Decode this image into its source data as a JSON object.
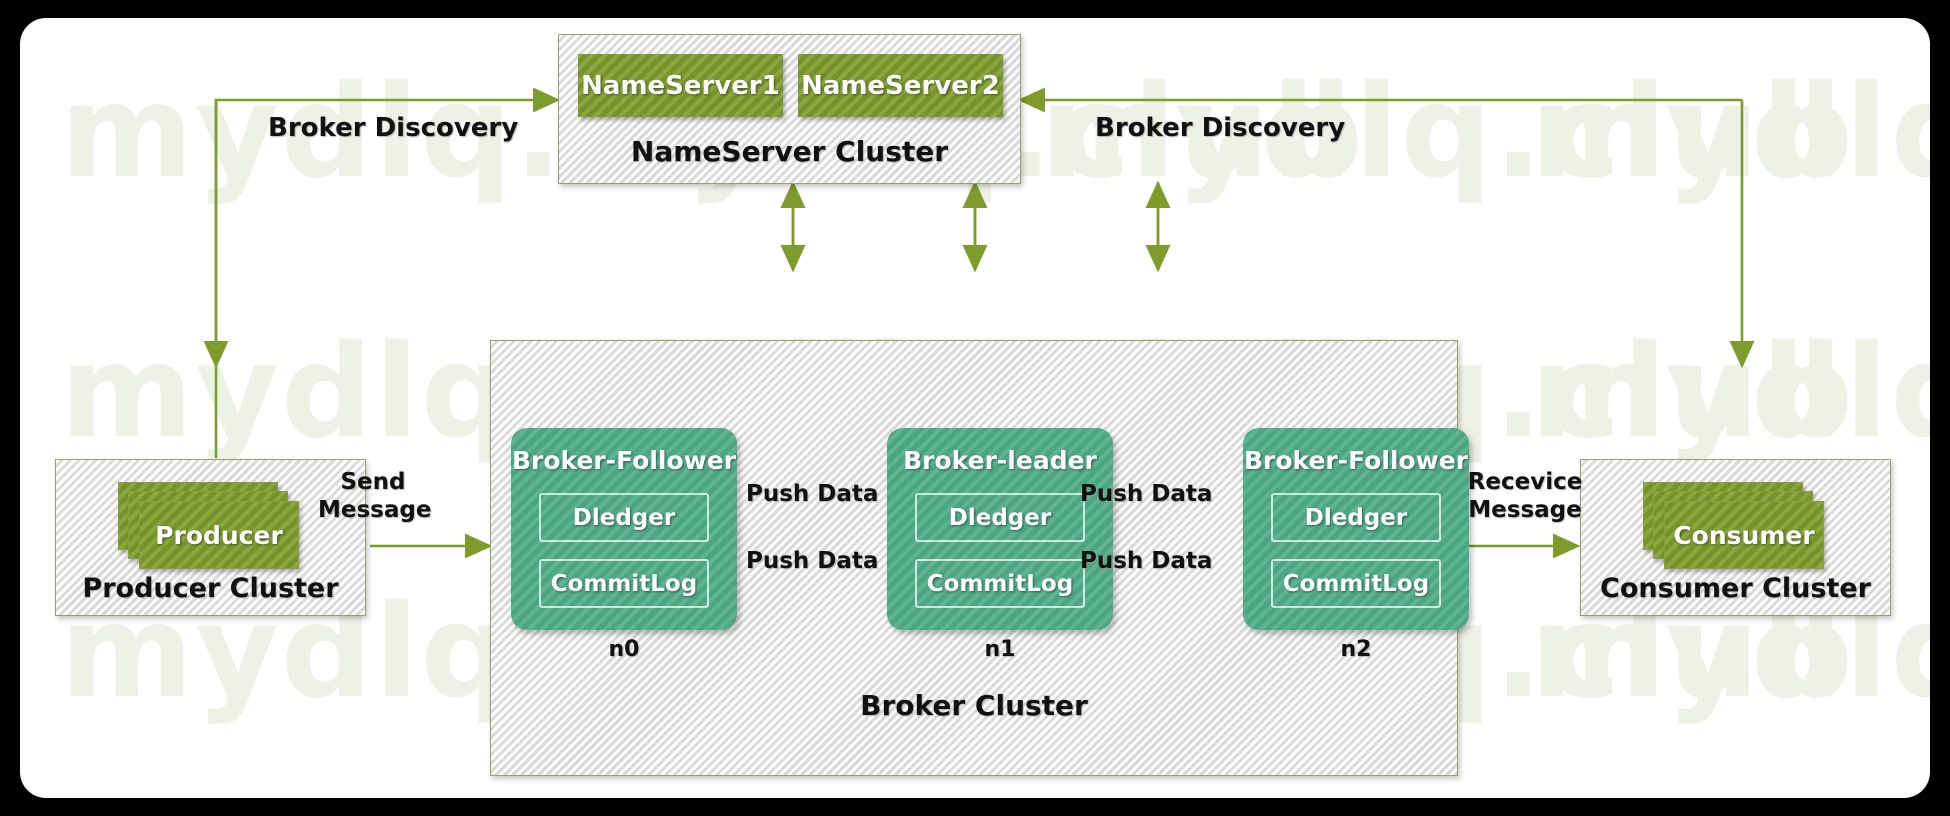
{
  "diagram": {
    "title": "RocketMQ DLedger Cluster Architecture",
    "watermark_text": "mydlq.club",
    "colors": {
      "olive_green": "#7d9c2b",
      "teal_green": "#4fac89",
      "arrow_green": "#7d9c2b",
      "arrow_brown": "#b5651d",
      "cluster_border": "#9aa06a",
      "cluster_fill": "#f2f2f2",
      "frame_black": "#000000"
    }
  },
  "nameserver_cluster": {
    "title": "NameServer Cluster",
    "nodes": [
      {
        "label": "NameServer1"
      },
      {
        "label": "NameServer2"
      }
    ]
  },
  "producer_cluster": {
    "title": "Producer Cluster",
    "node_label": "Producer"
  },
  "consumer_cluster": {
    "title": "Consumer Cluster",
    "node_label": "Consumer"
  },
  "broker_cluster": {
    "title": "Broker Cluster",
    "nodes": [
      {
        "title": "Broker-Follower",
        "tag": "n0",
        "components": [
          {
            "label": "Dledger"
          },
          {
            "label": "CommitLog"
          }
        ]
      },
      {
        "title": "Broker-leader",
        "tag": "n1",
        "components": [
          {
            "label": "Dledger"
          },
          {
            "label": "CommitLog"
          }
        ]
      },
      {
        "title": "Broker-Follower",
        "tag": "n2",
        "components": [
          {
            "label": "Dledger"
          },
          {
            "label": "CommitLog"
          }
        ]
      }
    ]
  },
  "edge_labels": {
    "broker_discovery_left": "Broker Discovery",
    "broker_discovery_right": "Broker Discovery",
    "send_message": "Send\nMessage",
    "send_message_line1": "Send",
    "send_message_line2": "Message",
    "receive_message_line1": "Recevice",
    "receive_message_line2": "Message",
    "push_data_left_top": "Push Data",
    "push_data_left_bottom": "Push Data",
    "push_data_right_top": "Push Data",
    "push_data_right_bottom": "Push Data"
  }
}
